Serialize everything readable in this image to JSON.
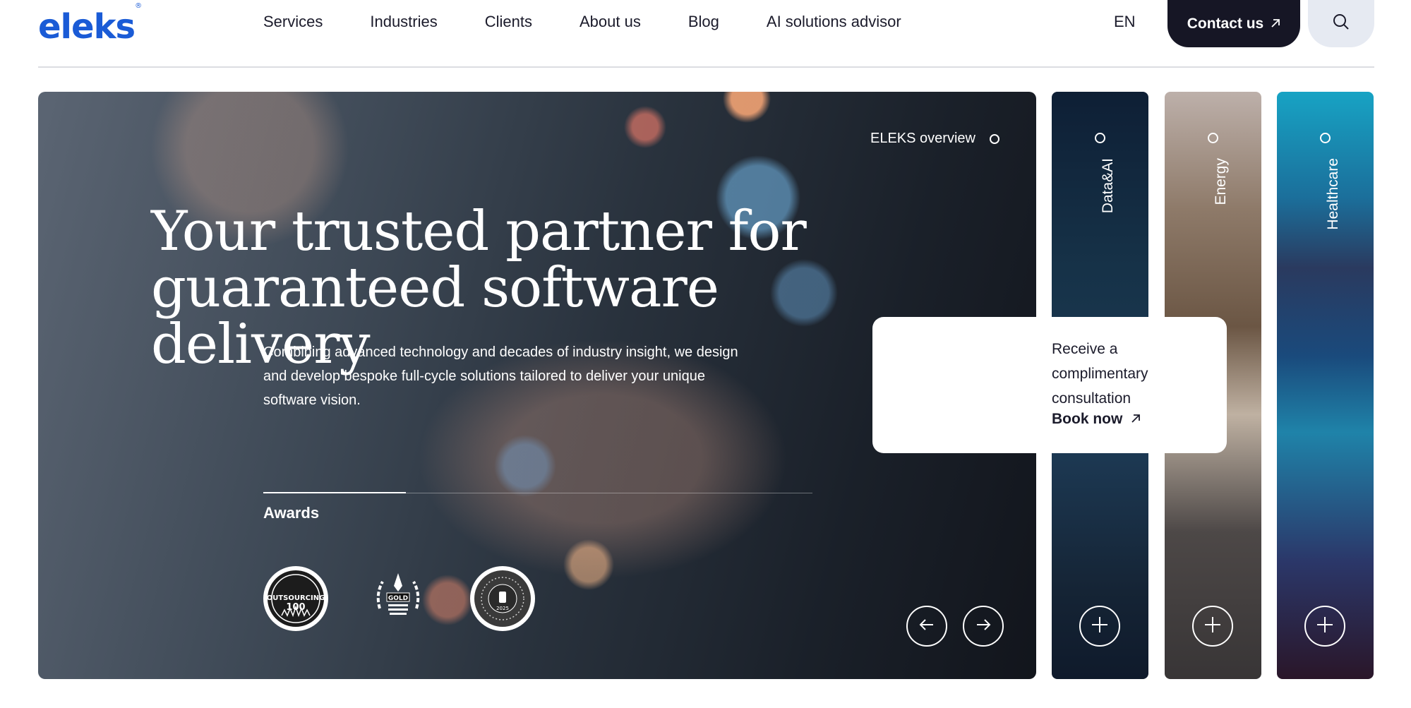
{
  "header": {
    "logo_text": "eleks",
    "logo_mark": "®",
    "nav": [
      "Services",
      "Industries",
      "Clients",
      "About us",
      "Blog",
      "AI solutions advisor"
    ],
    "language": "EN",
    "contact_label": "Contact us"
  },
  "hero": {
    "title_line1": "Your trusted partner for",
    "title_line2": "guaranteed software delivery",
    "subtitle": "Combining advanced technology and decades of industry insight, we design and develop bespoke full-cycle solutions tailored to deliver your unique software vision.",
    "awards_title": "Awards",
    "awards": [
      {
        "text": "OUTSOURCING",
        "number": "100"
      },
      {
        "text": "GOLD"
      },
      {
        "text": "2025"
      }
    ],
    "overview_label": "ELEKS overview"
  },
  "panels": [
    {
      "label": "Data&AI"
    },
    {
      "label": "Energy"
    },
    {
      "label": "Healthcare"
    }
  ],
  "consultation": {
    "text": "Receive a complimentary consultation",
    "link_label": "Book now"
  },
  "colors": {
    "brand": "#1a5bd6",
    "dark_button": "#161625",
    "search_bg": "#e6eaf2"
  }
}
